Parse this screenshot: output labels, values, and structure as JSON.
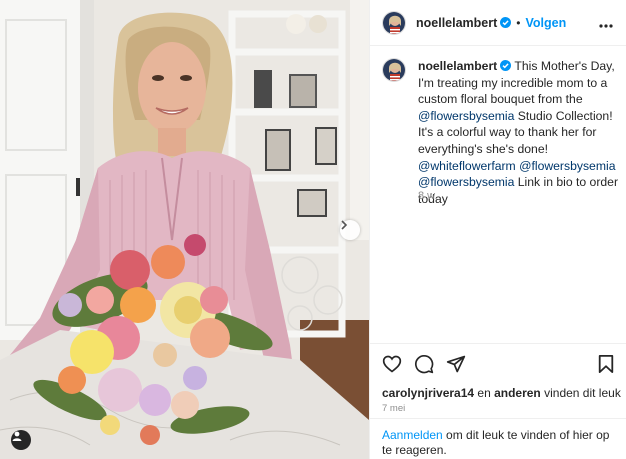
{
  "post": {
    "username": "noellelambert",
    "follow_label": "Volgen",
    "separator": "•",
    "caption": {
      "username": "noellelambert",
      "text_1": "This Mother's Day, I'm treating my incredible mom to a custom floral bouquet from the ",
      "mention_1": "@flowersbysemia",
      "text_2": " Studio Collection! It's a colorful way to thank her for everything's she's done! ",
      "mention_2": "@whiteflowerfarm",
      "text_3": " ",
      "mention_3": "@flowersbysemia",
      "text_4": " ",
      "mention_4": "@flowersbysemia",
      "text_5": " Link in bio to order today"
    },
    "time_ago": "8 w.",
    "likes": {
      "user": "carolynjrivera14",
      "middle": " en ",
      "others": "anderen",
      "suffix": " vinden dit leuk"
    },
    "date": "7 mei",
    "login": {
      "link": "Aanmelden",
      "text": " om dit leuk te vinden of hier op te reageren."
    }
  },
  "colors": {
    "accent": "#0095f6",
    "link_dark": "#00376b",
    "muted": "#8e8e8e",
    "text": "#262626"
  },
  "icons": [
    "verified-badge-icon",
    "more-options-icon",
    "heart-icon",
    "comment-icon",
    "share-icon",
    "bookmark-icon",
    "chevron-right-icon",
    "user-tag-icon"
  ]
}
